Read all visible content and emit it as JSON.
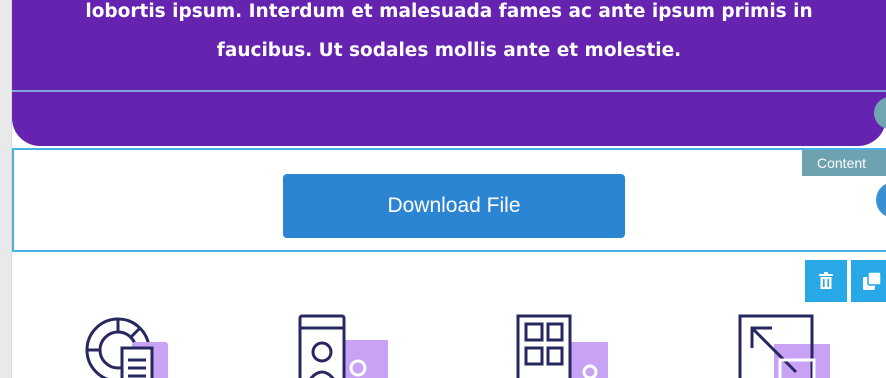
{
  "banner": {
    "line1": "lobortis ipsum. Interdum et malesuada fames ac ante ipsum primis in",
    "line2": "faucibus. Ut sodales mollis ante et molestie."
  },
  "download": {
    "label": "Download File"
  },
  "section": {
    "label": "Content"
  },
  "toolbar": {
    "delete_icon": "trash-icon",
    "duplicate_icon": "copy-icon"
  },
  "features": {
    "icons": [
      "chart-document-icon",
      "contact-profile-icon",
      "puzzle-grid-icon",
      "resize-arrow-icon"
    ]
  },
  "colors": {
    "banner": "#6623b0",
    "button": "#2c85d2",
    "accent": "#28a8e6",
    "icon_stroke": "#27285f",
    "icon_fill": "#c8a2f5"
  }
}
